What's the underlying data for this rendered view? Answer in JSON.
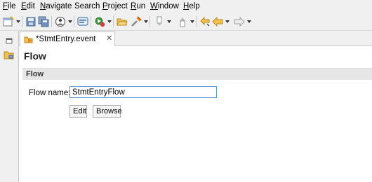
{
  "menu": [
    {
      "mnemonic": "F",
      "rest": "ile"
    },
    {
      "mnemonic": "E",
      "rest": "dit"
    },
    {
      "mnemonic": "N",
      "rest": "avigate"
    },
    {
      "mnemonic": "",
      "rest": "Search"
    },
    {
      "mnemonic": "P",
      "rest": "roject"
    },
    {
      "mnemonic": "R",
      "rest": "un"
    },
    {
      "mnemonic": "W",
      "rest": "indow"
    },
    {
      "mnemonic": "H",
      "rest": "elp"
    }
  ],
  "toolbar": {
    "icons": [
      "new-icon",
      "save-icon",
      "save-all-icon",
      "profile-icon",
      "console-icon",
      "run-icon",
      "open-folder-icon",
      "tools-icon",
      "next-annotation-icon",
      "prev-annotation-icon",
      "back-icon",
      "forward-icon"
    ]
  },
  "editor_tab": {
    "label": "*StmtEntry.event",
    "close": "✕"
  },
  "form": {
    "title": "Flow",
    "section": "Flow",
    "flow_name_label": "Flow name:",
    "flow_name_value": "StmtEntryFlow",
    "edit_label": "Edit",
    "browse_label": "Browse"
  },
  "colors": {
    "accent_border": "#5b9bd5",
    "chrome_bg": "#f0f0f0"
  }
}
